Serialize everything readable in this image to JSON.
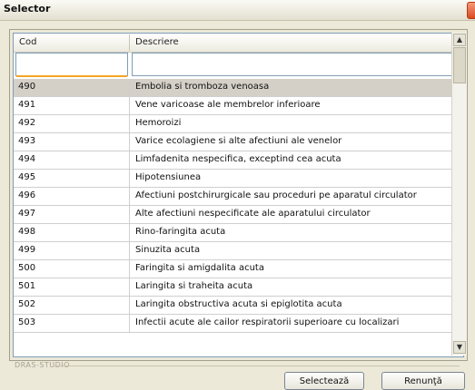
{
  "window": {
    "title": "Selector"
  },
  "grid": {
    "columns": [
      "Cod",
      "Descriere"
    ],
    "filters": {
      "cod": "",
      "descriere": ""
    },
    "rows": [
      {
        "cod": "490",
        "descriere": "Embolia si tromboza venoasa"
      },
      {
        "cod": "491",
        "descriere": "Vene varicoase ale membrelor inferioare"
      },
      {
        "cod": "492",
        "descriere": "Hemoroizi"
      },
      {
        "cod": "493",
        "descriere": "Varice ecolagiene si alte afectiuni ale venelor"
      },
      {
        "cod": "494",
        "descriere": "Limfadenita nespecifica, exceptind cea acuta"
      },
      {
        "cod": "495",
        "descriere": "Hipotensiunea"
      },
      {
        "cod": "496",
        "descriere": "Afectiuni postchirurgicale sau proceduri pe aparatul circulator"
      },
      {
        "cod": "497",
        "descriere": "Alte afectiuni nespecificate ale aparatului circulator"
      },
      {
        "cod": "498",
        "descriere": "Rino-faringita acuta"
      },
      {
        "cod": "499",
        "descriere": "Sinuzita acuta"
      },
      {
        "cod": "500",
        "descriere": "Faringita si amigdalita acuta"
      },
      {
        "cod": "501",
        "descriere": "Laringita si traheita acuta"
      },
      {
        "cod": "502",
        "descriere": "Laringita obstructiva acuta si epiglotita acuta"
      },
      {
        "cod": "503",
        "descriere": "Infectii acute ale cailor respiratorii superioare cu localizari"
      }
    ],
    "selected_index": 0
  },
  "footer": {
    "label": "DRAS-STUDIO",
    "select_label": "Selectează",
    "cancel_label": "Renunţă"
  },
  "icons": {
    "scroll_up": "arrow-up-icon",
    "scroll_down": "arrow-down-icon",
    "close": "close-icon"
  }
}
